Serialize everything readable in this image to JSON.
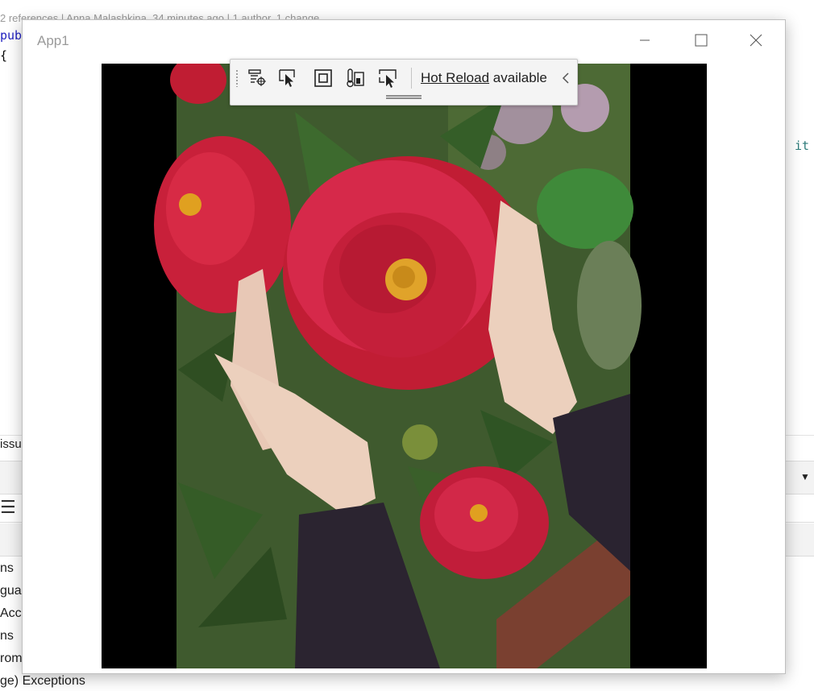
{
  "ide": {
    "codelens": "2 references | Anna Malashkina, 34 minutes ago | 1 author, 1 change",
    "code_line1": "pub",
    "code_line2": "{",
    "code_right": "it",
    "issues_text": "issu",
    "list_items": [
      "ns",
      "gua",
      "Acc",
      "ns",
      "rom",
      "ge) Exceptions"
    ]
  },
  "app": {
    "title": "App1",
    "minimize_icon": "minimize-icon",
    "maximize_icon": "maximize-icon",
    "close_icon": "close-icon"
  },
  "xaml_toolbar": {
    "buttons": [
      {
        "name": "go-to-live-visual-tree-icon"
      },
      {
        "name": "select-element-icon"
      },
      {
        "name": "display-layout-adorners-icon"
      },
      {
        "name": "track-focus-icon"
      },
      {
        "name": "binding-failures-icon"
      }
    ],
    "hot_reload_link": "Hot Reload",
    "hot_reload_suffix": " available",
    "collapse_icon": "chevron-left-icon"
  },
  "image": {
    "description_alt": "red peony"
  },
  "colors": {
    "window_title": "#9a9a9a",
    "content_bg": "#000000",
    "toolbar_bg": "#f4f4f4"
  }
}
